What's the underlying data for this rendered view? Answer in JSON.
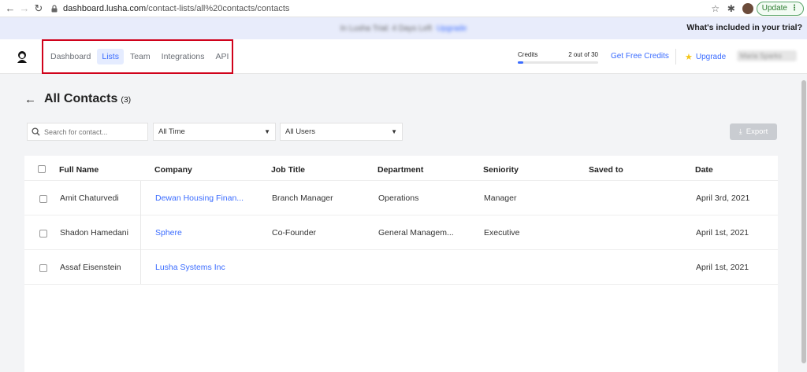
{
  "browser": {
    "url_host": "dashboard.lusha.com",
    "url_path": "/contact-lists/all%20contacts/contacts",
    "update_label": "Update"
  },
  "banner": {
    "trial_text": "In Lusha Trial: 4 Days Left",
    "trial_link": "Upgrade",
    "whats_included": "What's included in your trial?"
  },
  "nav": {
    "items": [
      {
        "label": "Dashboard",
        "active": false
      },
      {
        "label": "Lists",
        "active": true
      },
      {
        "label": "Team",
        "active": false
      },
      {
        "label": "Integrations",
        "active": false
      },
      {
        "label": "API",
        "active": false
      }
    ],
    "credits_label": "Credits",
    "credits_value": "2 out of 30",
    "credits_used_fraction": 0.07,
    "get_free_credits": "Get Free Credits",
    "upgrade": "Upgrade",
    "user_name_blurred": "Maria Sparks"
  },
  "page": {
    "title": "All Contacts",
    "count": "(3)",
    "search_placeholder": "Search for contact...",
    "time_filter": "All Time",
    "users_filter": "All Users",
    "export_label": "Export"
  },
  "table": {
    "columns": [
      "Full Name",
      "Company",
      "Job Title",
      "Department",
      "Seniority",
      "Saved to",
      "Date"
    ],
    "rows": [
      {
        "name": "Amit Chaturvedi",
        "company": "Dewan Housing Finan...",
        "job": "Branch Manager",
        "dept": "Operations",
        "seniority": "Manager",
        "saved_to": "",
        "date": "April 3rd, 2021"
      },
      {
        "name": "Shadon Hamedani",
        "company": "Sphere",
        "job": "Co-Founder",
        "dept": "General Managem...",
        "seniority": "Executive",
        "saved_to": "",
        "date": "April 1st, 2021"
      },
      {
        "name": "Assaf Eisenstein",
        "company": "Lusha Systems Inc",
        "job": "",
        "dept": "",
        "seniority": "",
        "saved_to": "",
        "date": "April 1st, 2021"
      }
    ]
  },
  "colors": {
    "accent": "#3b6cff",
    "highlight_box": "#d0021b",
    "banner_bg": "#e8ecfb"
  }
}
